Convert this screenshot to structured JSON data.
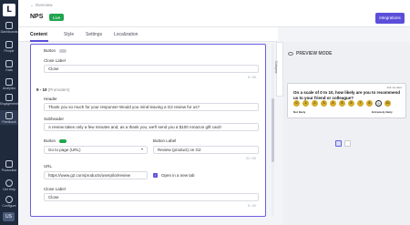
{
  "sidebar": {
    "logo": "L",
    "items": [
      {
        "label": "Dashboards"
      },
      {
        "label": "People"
      },
      {
        "label": "Data"
      },
      {
        "label": "Analytics"
      },
      {
        "label": "Engagement"
      },
      {
        "label": "Feedback"
      }
    ],
    "bottom": [
      {
        "label": "Production"
      },
      {
        "label": "Get Help"
      },
      {
        "label": "Configure"
      }
    ],
    "avatar": "US"
  },
  "header": {
    "back_label": "← Overview",
    "title": "NPS",
    "status_badge": "Live",
    "integrations_button": "Integrations"
  },
  "tabs": [
    {
      "label": "Content"
    },
    {
      "label": "Style"
    },
    {
      "label": "Settings"
    },
    {
      "label": "Localization"
    }
  ],
  "form": {
    "first_button_label": "Button",
    "close_label_title": "Close Label",
    "close_label_value": "Close",
    "close_label_counter": "5 / 40",
    "section_title": "9 - 10",
    "section_sub": "(Promoters)",
    "header_label": "Header",
    "header_value": "Thank you so much for your response! Would you mind leaving a G2 review for us?",
    "subheader_label": "Subheader",
    "subheader_value": "A review takes only a few minutes and, as a thank you, we'll send you a $100 Amazon gift card!",
    "button_label": "Button",
    "button_select_value": "Go to page (URL)",
    "button_label_title": "Button Label",
    "button_label_value": "Review (product) on G2",
    "button_label_counter": "21 / 40",
    "url_label": "URL",
    "url_value": "https://www.g2.com/products/userpilot/review",
    "new_tab_label": "Open in a new tab",
    "close_label2_title": "Close Label",
    "close_label2_value": "Close",
    "close_label2_counter": "5 / 40"
  },
  "preview": {
    "mode_label": "PREVIEW MODE",
    "collapse_label": "Collapse",
    "note": "Ask me later",
    "question": "On a scale of 0 to 10, how likely are you to recommend us to your friend or colleague?",
    "scale": [
      "0",
      "1",
      "2",
      "3",
      "4",
      "5",
      "6",
      "7",
      "8",
      "9",
      "10"
    ],
    "selected_index": 9,
    "low_label": "Not likely",
    "high_label": "Extremely likely"
  },
  "colors": {
    "accent": "#5b4fd9",
    "live": "#22a54f",
    "nps_bubble": "#d4ab2a",
    "sidebar": "#1f2a3d"
  }
}
